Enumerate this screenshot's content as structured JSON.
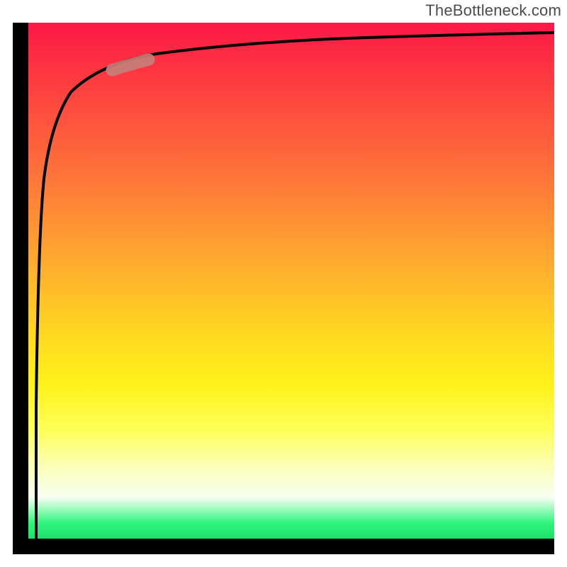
{
  "attribution": "TheBottleneck.com",
  "chart_data": {
    "type": "line",
    "title": "",
    "xlabel": "",
    "ylabel": "",
    "xlim": [
      0,
      100
    ],
    "ylim": [
      0,
      100
    ],
    "series": [
      {
        "name": "bottleneck-curve",
        "x": [
          0,
          1,
          2,
          3,
          4,
          5,
          7,
          10,
          15,
          20,
          30,
          40,
          50,
          60,
          70,
          80,
          90,
          100
        ],
        "y": [
          0,
          35,
          55,
          67,
          74,
          79,
          84,
          88,
          91,
          92.5,
          94,
          95,
          95.8,
          96.4,
          96.9,
          97.3,
          97.6,
          97.9
        ]
      },
      {
        "name": "highlight-segment",
        "x": [
          16,
          22
        ],
        "y": [
          91.3,
          92.8
        ]
      }
    ],
    "gradient_stops": [
      {
        "pos": 0,
        "color": "#fc1847"
      },
      {
        "pos": 28,
        "color": "#fe6f3a"
      },
      {
        "pos": 60,
        "color": "#ffd722"
      },
      {
        "pos": 79,
        "color": "#fdff58"
      },
      {
        "pos": 92,
        "color": "#f7fff2"
      },
      {
        "pos": 100,
        "color": "#1ee06c"
      }
    ]
  }
}
